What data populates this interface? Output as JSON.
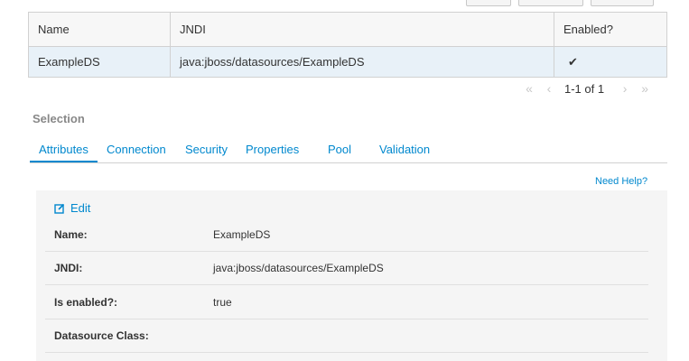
{
  "table": {
    "headers": [
      "Name",
      "JNDI",
      "Enabled?"
    ],
    "rows": [
      {
        "name": "ExampleDS",
        "jndi": "java:jboss/datasources/ExampleDS",
        "enabled": "✔"
      }
    ]
  },
  "pager": {
    "first_icon": "«",
    "prev_icon": "‹",
    "text": "1-1 of 1",
    "next_icon": "›",
    "last_icon": "»"
  },
  "selection_label": "Selection",
  "tabs": [
    {
      "label": "Attributes"
    },
    {
      "label": "Connection"
    },
    {
      "label": "Security"
    },
    {
      "label": "Properties"
    },
    {
      "label": "Pool"
    },
    {
      "label": "Validation"
    }
  ],
  "need_help": "Need Help?",
  "edit_label": "Edit",
  "form": [
    {
      "label": "Name:",
      "value": "ExampleDS"
    },
    {
      "label": "JNDI:",
      "value": "java:jboss/datasources/ExampleDS"
    },
    {
      "label": "Is enabled?:",
      "value": "true"
    },
    {
      "label": "Datasource Class:",
      "value": ""
    }
  ],
  "colors": {
    "accent": "#0088ce",
    "selected_row": "#e8f1f8",
    "panel_bg": "#f5f5f5"
  }
}
